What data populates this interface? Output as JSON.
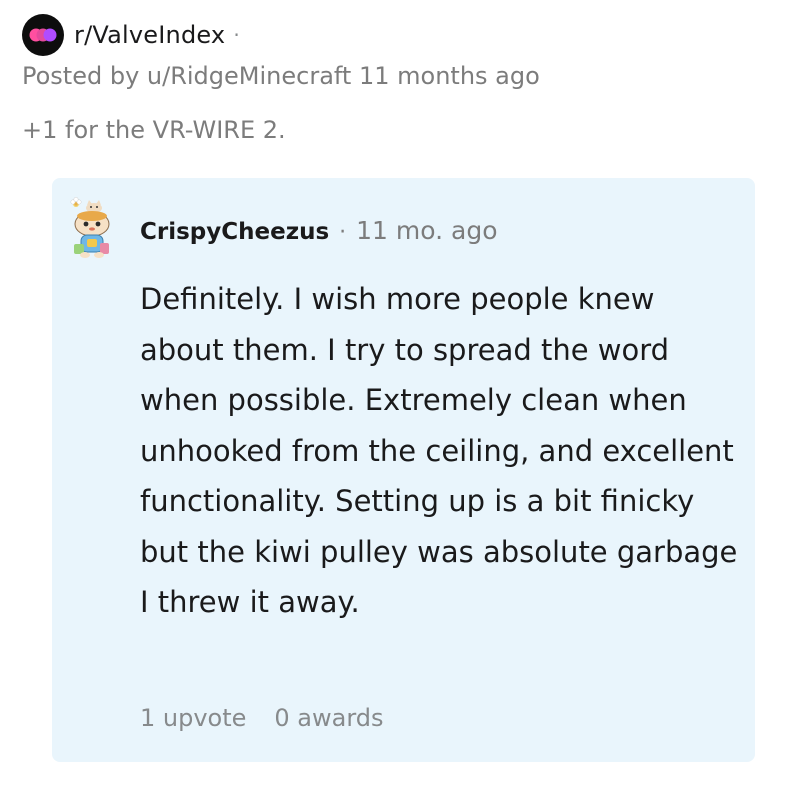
{
  "post": {
    "subreddit": "r/ValveIndex",
    "separator": "·",
    "posted_by": "Posted by u/RidgeMinecraft 11 months ago",
    "text": "+1 for the VR-WIRE 2."
  },
  "reply": {
    "username": "CrispyCheezus",
    "separator": "·",
    "time": "11 mo. ago",
    "body": "Definitely. I wish more people knew about them. I try to spread the word when possible. Extremely clean when unhooked from the ceiling, and excellent functionality. Setting up is a bit finicky but the kiwi pulley was absolute garbage I threw it away.",
    "upvotes": "1 upvote",
    "awards": "0 awards"
  },
  "colors": {
    "card_background": "#e9f5fc",
    "icon_background": "#0d0d0d",
    "icon_accent_pink": "#ff4fa0",
    "icon_accent_purple": "#b04cff",
    "muted_text": "#7c7c7c"
  },
  "icons": {
    "subreddit": "subreddit-community-icon",
    "avatar": "user-avatar-snoo"
  }
}
